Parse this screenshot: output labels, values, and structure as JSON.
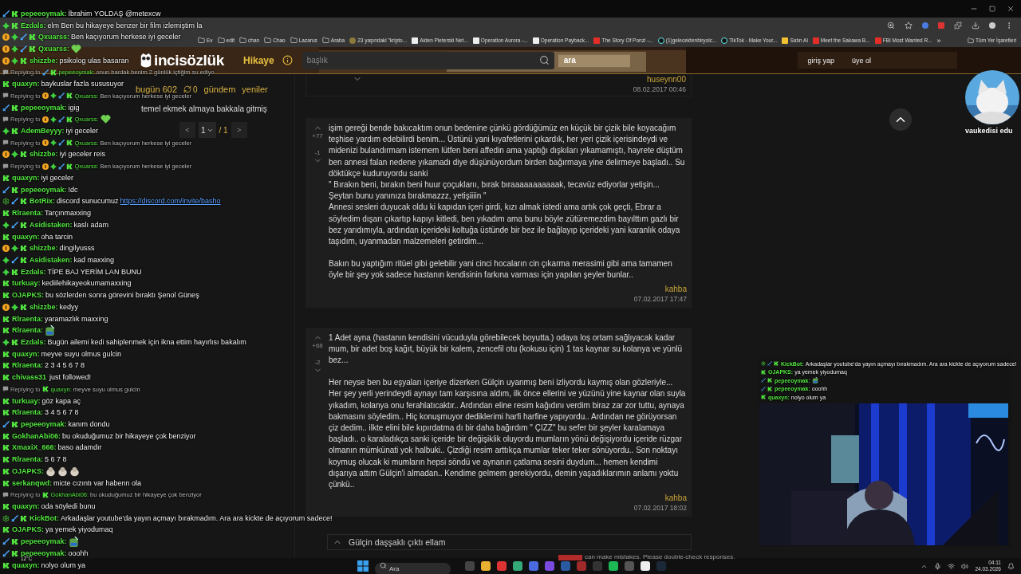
{
  "bookmarks": [
    {
      "kind": "folder",
      "label": "Ev"
    },
    {
      "kind": "folder",
      "label": "edit"
    },
    {
      "kind": "folder",
      "label": "chan"
    },
    {
      "kind": "folder",
      "label": "Chao"
    },
    {
      "kind": "folder",
      "label": "Lazarus"
    },
    {
      "kind": "folder",
      "label": "Araba"
    },
    {
      "kind": "site",
      "label": "23 yaşındaki \"kripto..."
    },
    {
      "kind": "wiki",
      "label": "Aiden Pleterski Net..."
    },
    {
      "kind": "wiki",
      "label": "Operation Aurora -..."
    },
    {
      "kind": "wiki",
      "label": "Operation Payback..."
    },
    {
      "kind": "video",
      "label": "The Story Of Ponzi -..."
    },
    {
      "kind": "tiktok",
      "label": "(1)gelecektenbiryolc..."
    },
    {
      "kind": "tiktok",
      "label": "TikTok - Make Your..."
    },
    {
      "kind": "shop",
      "label": "Satın Al"
    },
    {
      "kind": "video",
      "label": "Meet the Sakawa B..."
    },
    {
      "kind": "video",
      "label": "FBI Most Wanted R..."
    }
  ],
  "bookmarks_more": "»",
  "bookmarks_all": "Tüm Yer İşaretleri",
  "site_header": {
    "logo": "incisözlük",
    "section": "Hikaye",
    "search": {
      "placeholder": "başlık"
    },
    "search_button": "ara",
    "links": [
      "giriş yap",
      "üye ol"
    ]
  },
  "sidebar": {
    "today": "bugün 602",
    "refresh_count": "0",
    "links": [
      "gündem",
      "yeniler"
    ],
    "topic": "temel ekmek almaya bakkala gitmiş",
    "pagination": {
      "prev": "<",
      "page": "1",
      "total": "/ 1",
      "next": ">"
    }
  },
  "previous_entry": {
    "author": "huseynn00",
    "date": "08.02.2017 00:46"
  },
  "entries": [
    {
      "upvotes": "+77",
      "downvotes": "-1",
      "paragraphs": [
        [
          "işim gereği bende bakıcaktım onun bedenine çünkü gördüğümüz en küçük bir çizik bile koyacağım teşhise yardım edebilirdi benim... Üstünü yani kıyafetlerini çıkardık, her yeri çizik içerisindeydi ve midenizi bulandırmam istemem lütfen beni affedin ama yaptığı dışkıları yıkamamıştı, hayrete düştüm ben annesi falan nedene yıkamadı diye düşünüyordum birden bağırmaya yine delirmeye başladı.. Su döktükçe kuduruyordu sanki",
          "\" Bırakın beni, bırakın beni huur çoçuklarıı, bırak bıraaaaaaaaaaak, tecavüz ediyorlar yetişin...",
          "Şeytan bunu yanınıza bırakmazzz, yetişiiiin \"",
          "Annesi sesleri duyucak oldu ki kapıdan içeri girdi, kızı almak istedi ama artık çok geçti, Ebrar a söyledim dışarı çıkartıp kapıyı kitledi, ben yıkadım ama bunu böyle zütüremezdim bayılttım gazlı bir bez yarıdımıyla, ardından içerideki koltuğa üstünde bir bez ile bağlayıp içerideki yani karanlık odaya taşıdım, uyanmadan malzemeleri getirdim..."
        ],
        [
          "Bakın bu yaptığım ritüel gibi gelebilir yani cinci hocaların cin çıkarma merasimi gibi ama tamamen öyle bir şey yok sadece hastanın kendisinin farkına varması için yapılan şeyler bunlar.."
        ]
      ],
      "author": "kahba",
      "date": "07.02.2017 17:47"
    },
    {
      "upvotes": "+68",
      "downvotes": "-2",
      "paragraphs": [
        [
          "1 Adet ayna (hastanın kendisini vücuduyla görebilecek boyutta.) odaya loş ortam sağlıyacak kadar mum, bir adet boş kağıt, büyük bir kalem, zencefil otu (kokusu için) 1 tas kaynar su kolanya ve yünlü bez..."
        ],
        [
          "Her neyse ben bu eşyaları içeriye dizerken Gülçin uyanmış beni izliyordu kaymış olan gözleriyle... Her şey yerli yerindeydi aynayı tam karşısına aldım, ilk önce ellerini ve yüzünü yine kaynar olan suyla yıkadım, kolanya onu ferahlatıcaktır.. Ardından eline resim kağıdını verdim biraz zar zor tuttu, aynaya bakmasını söyledim.. Hiç konuşmuyor dediklerimi harfi harfine yapıyordu.. Ardından ne görüyorsan çiz dedim.. ilkte elini bile kıpırdatma dı bir daha bağırdım \" ÇIZZ\" bu sefer bir şeyler karalamaya başladı.. o karaladıkça sanki içeride bir değişiklik oluyordu mumların yönü değişiyordu içeride rüzgar olmanın mümkünati yok halbuki.. Çizdiği resim arttıkça mumlar teker teker sönüyordu.. Son noktayı koymuş olucak ki mumların hepsi söndü ve aynanın çatlama sesini duydum... hemen kendimi dışarıya attım Gülçin'i almadan.. Kendime gelmem gerekiyordu, demin yaşadıklarımın anlamı yoktu çünkü.."
        ]
      ],
      "author": "kahba",
      "date": "07.02.2017 18:02"
    }
  ],
  "reply_preview": "Gülçin daşşaklı çıktı ellam",
  "overlay_profile": {
    "caption": "vaukedisi edu"
  },
  "chat": [
    {
      "kind": "message",
      "badges": [
        {
          "kind": "sword"
        },
        {
          "kind": "kick"
        }
      ],
      "user": "pepeeoymak:",
      "text": "İbrahim YOLDAŞ @metexcw"
    },
    {
      "kind": "message",
      "badges": [
        {
          "kind": "gift"
        },
        {
          "kind": "kick"
        }
      ],
      "user": "Ezdals:",
      "text": "elm Ben bu hikayeye benzer bir film izlemiştim la"
    },
    {
      "kind": "message",
      "badges": [
        {
          "kind": "sub"
        },
        {
          "kind": "gift"
        },
        {
          "kind": "sword"
        },
        {
          "kind": "kick"
        }
      ],
      "user": "Qxuarss:",
      "text": "Ben kaçıyorum herkese iyi geceler"
    },
    {
      "kind": "message",
      "badges": [
        {
          "kind": "sub"
        },
        {
          "kind": "gift"
        },
        {
          "kind": "sword"
        },
        {
          "kind": "kick"
        }
      ],
      "user": "Qxuarss:",
      "emotes": [
        {
          "kind": "heart"
        }
      ]
    },
    {
      "kind": "message",
      "badges": [
        {
          "kind": "sub"
        },
        {
          "kind": "gift"
        },
        {
          "kind": "kick"
        }
      ],
      "user": "shizzbe:",
      "text": "psikolog ulas basaran"
    },
    {
      "kind": "reply",
      "label": "Replying to",
      "badges": [
        {
          "kind": "sword"
        },
        {
          "kind": "kick"
        }
      ],
      "user": "pepeeoymak:",
      "text": "onun bardak benim 2 günlük içtiğim su ediyo"
    },
    {
      "kind": "message",
      "badges": [
        {
          "kind": "kick"
        }
      ],
      "user": "quaxyn:",
      "text": "baykuslar fazla sususuyor"
    },
    {
      "kind": "reply",
      "label": "Replying to",
      "badges": [
        {
          "kind": "sub"
        },
        {
          "kind": "gift"
        },
        {
          "kind": "sword"
        },
        {
          "kind": "kick"
        }
      ],
      "user": "Qxuarss:",
      "text": "Ben kaçıyorum herkese iyi geceler"
    },
    {
      "kind": "message",
      "badges": [
        {
          "kind": "sword"
        },
        {
          "kind": "kick"
        }
      ],
      "user": "pepeeoymak:",
      "text": "igig"
    },
    {
      "kind": "reply",
      "label": "Replying to",
      "badges": [
        {
          "kind": "sub"
        },
        {
          "kind": "gift"
        },
        {
          "kind": "sword"
        },
        {
          "kind": "kick"
        }
      ],
      "user": "Qxuarss:",
      "emotes": [
        {
          "kind": "heart"
        }
      ]
    },
    {
      "kind": "message",
      "badges": [
        {
          "kind": "gift"
        },
        {
          "kind": "kick"
        }
      ],
      "user": "AdemBeyyy:",
      "text": "iyi geceler"
    },
    {
      "kind": "reply",
      "label": "Replying to",
      "badges": [
        {
          "kind": "sub"
        },
        {
          "kind": "gift"
        },
        {
          "kind": "sword"
        },
        {
          "kind": "kick"
        }
      ],
      "user": "Qxuarss:",
      "text": "Ben kaçıyorum herkese iyi geceler"
    },
    {
      "kind": "message",
      "badges": [
        {
          "kind": "sub"
        },
        {
          "kind": "gift"
        },
        {
          "kind": "kick"
        }
      ],
      "user": "shizzbe:",
      "text": "iyi geceler reis"
    },
    {
      "kind": "reply",
      "label": "Replying to",
      "badges": [
        {
          "kind": "sub"
        },
        {
          "kind": "gift"
        },
        {
          "kind": "sword"
        },
        {
          "kind": "kick"
        }
      ],
      "user": "Qxuarss:",
      "text": "Ben kaçıyorum herkese iyi geceler"
    },
    {
      "kind": "message",
      "badges": [
        {
          "kind": "kick"
        }
      ],
      "user": "quaxyn:",
      "text": "iyi geceler"
    },
    {
      "kind": "message",
      "badges": [
        {
          "kind": "sword"
        },
        {
          "kind": "kick"
        }
      ],
      "user": "pepeeoymak:",
      "text": "!dc"
    },
    {
      "kind": "message",
      "badges": [
        {
          "kind": "bot"
        },
        {
          "kind": "sword"
        },
        {
          "kind": "kick"
        }
      ],
      "user": "BotRix:",
      "text": "discord sunucumuz",
      "link": "https://discord.com/invite/basho"
    },
    {
      "kind": "message",
      "badges": [
        {
          "kind": "kick"
        }
      ],
      "user": "Rlraenta:",
      "text": "Tarçınmaxxing"
    },
    {
      "kind": "message",
      "badges": [
        {
          "kind": "gift"
        },
        {
          "kind": "sword"
        },
        {
          "kind": "kick"
        }
      ],
      "user": "Asidistaken:",
      "text": "kaslı adam"
    },
    {
      "kind": "message",
      "badges": [
        {
          "kind": "kick"
        }
      ],
      "user": "quaxyn:",
      "text": "oha tarcin"
    },
    {
      "kind": "message",
      "badges": [
        {
          "kind": "sub"
        },
        {
          "kind": "gift"
        },
        {
          "kind": "kick"
        }
      ],
      "user": "shizzbe:",
      "text": "dingilyusss"
    },
    {
      "kind": "message",
      "badges": [
        {
          "kind": "gift"
        },
        {
          "kind": "sword"
        },
        {
          "kind": "kick"
        }
      ],
      "user": "Asidistaken:",
      "text": "kad maxxing"
    },
    {
      "kind": "message",
      "badges": [
        {
          "kind": "gift"
        },
        {
          "kind": "kick"
        }
      ],
      "user": "Ezdals:",
      "text": "TİPE BAJ YERİM LAN BUNU"
    },
    {
      "kind": "message",
      "badges": [
        {
          "kind": "kick"
        }
      ],
      "user": "turkuay:",
      "text": "kediilehikayeokumamaxxing"
    },
    {
      "kind": "message",
      "badges": [
        {
          "kind": "kick"
        }
      ],
      "user": "OJAPKS:",
      "text": "bu sözlerden sonra görevini bıraktı Şenol Güneş"
    },
    {
      "kind": "message",
      "badges": [
        {
          "kind": "sub"
        },
        {
          "kind": "gift"
        },
        {
          "kind": "kick"
        }
      ],
      "user": "shizzbe:",
      "text": "kedyy"
    },
    {
      "kind": "message",
      "badges": [
        {
          "kind": "kick"
        }
      ],
      "user": "Rlraenta:",
      "text": "yaramazlık maxxing"
    },
    {
      "kind": "message",
      "badges": [
        {
          "kind": "kick"
        }
      ],
      "user": "Rlraenta:",
      "emotes": [
        {
          "kind": "frog"
        }
      ]
    },
    {
      "kind": "message",
      "badges": [
        {
          "kind": "gift"
        },
        {
          "kind": "kick"
        }
      ],
      "user": "Ezdals:",
      "text": "Bugün ailemi kedi sahiplenmek için ikna ettim hayırlısı bakalım"
    },
    {
      "kind": "message",
      "badges": [
        {
          "kind": "kick"
        }
      ],
      "user": "quaxyn:",
      "text": "meyve suyu olmus gulcin"
    },
    {
      "kind": "message",
      "badges": [
        {
          "kind": "kick"
        }
      ],
      "user": "Rlraenta:",
      "text": "2 3 4 5 6 7 8"
    },
    {
      "kind": "follow",
      "badges": [
        {
          "kind": "kick"
        }
      ],
      "user": "chivass31",
      "text": "just followed!"
    },
    {
      "kind": "reply",
      "label": "Replying to",
      "badges": [
        {
          "kind": "kick"
        }
      ],
      "user": "quaxyn:",
      "text": "meyve suyu olmus gulcin"
    },
    {
      "kind": "message",
      "badges": [
        {
          "kind": "kick"
        }
      ],
      "user": "turkuay:",
      "text": "göz kapa aç"
    },
    {
      "kind": "message",
      "badges": [
        {
          "kind": "kick"
        }
      ],
      "user": "Rlraenta:",
      "text": "3 4 5 6 7 8"
    },
    {
      "kind": "message",
      "badges": [
        {
          "kind": "sword"
        },
        {
          "kind": "kick"
        }
      ],
      "user": "pepeeoymak:",
      "text": "kanım dondu"
    },
    {
      "kind": "message",
      "badges": [
        {
          "kind": "kick"
        }
      ],
      "user": "GokhanAbi06:",
      "text": "bu okuduğumuz bir hikayeye çok benziyor"
    },
    {
      "kind": "message",
      "badges": [
        {
          "kind": "kick"
        }
      ],
      "user": "XmaxiX_666:",
      "text": "baso adamdır"
    },
    {
      "kind": "message",
      "badges": [
        {
          "kind": "kick"
        }
      ],
      "user": "Rlraenta:",
      "text": "5 6 7 8"
    },
    {
      "kind": "message",
      "badges": [
        {
          "kind": "kick"
        }
      ],
      "user": "OJAPKS:",
      "emotes": [
        {
          "kind": "pigeon"
        },
        {
          "kind": "pigeon"
        },
        {
          "kind": "pigeon"
        }
      ]
    },
    {
      "kind": "message",
      "badges": [
        {
          "kind": "kick"
        }
      ],
      "user": "serkanqwd:",
      "text": "micte cızıntı var habenn ola"
    },
    {
      "kind": "reply",
      "label": "Replying to",
      "badges": [
        {
          "kind": "kick"
        }
      ],
      "user": "GokhanAbi06:",
      "text": "bu okuduğumuz bir hikayeye çok benziyor"
    },
    {
      "kind": "message",
      "badges": [
        {
          "kind": "kick"
        }
      ],
      "user": "quaxyn:",
      "text": "oda söyledi bunu"
    },
    {
      "kind": "message",
      "badges": [
        {
          "kind": "bot"
        },
        {
          "kind": "sword"
        },
        {
          "kind": "kick"
        }
      ],
      "user": "KickBot:",
      "text": "Arkadaşlar youtube'da yayın açmayı bırakmadım. Ara ara kickte de açıyorum sadece!"
    },
    {
      "kind": "message",
      "badges": [
        {
          "kind": "kick"
        }
      ],
      "user": "OJAPKS:",
      "text": "ya yemek yiyodumaq"
    },
    {
      "kind": "message",
      "badges": [
        {
          "kind": "sword"
        },
        {
          "kind": "kick"
        }
      ],
      "user": "pepeeoymak:",
      "emotes": [
        {
          "kind": "frog"
        }
      ]
    },
    {
      "kind": "message",
      "badges": [
        {
          "kind": "sword"
        },
        {
          "kind": "kick"
        }
      ],
      "user": "pepeeoymak:",
      "text": "ooohh"
    },
    {
      "kind": "message",
      "badges": [
        {
          "kind": "kick"
        }
      ],
      "user": "quaxyn:",
      "text": "nolyo olum ya"
    }
  ],
  "mini_chat": [
    {
      "kind": "message",
      "badges": [
        {
          "kind": "bot"
        },
        {
          "kind": "sword"
        },
        {
          "kind": "kick"
        }
      ],
      "user": "KickBot:",
      "text": "Arkadaşlar youtube'da yayın açmayı bırakmadım. Ara ara kickte de açıyorum sadece!"
    },
    {
      "kind": "message",
      "badges": [
        {
          "kind": "kick"
        }
      ],
      "user": "OJAPKS:",
      "text": "ya yemek yiyodumaq"
    },
    {
      "kind": "message",
      "badges": [
        {
          "kind": "sword"
        },
        {
          "kind": "kick"
        }
      ],
      "user": "pepeeoymak:",
      "emotes": [
        {
          "kind": "frog"
        }
      ]
    },
    {
      "kind": "message",
      "badges": [
        {
          "kind": "sword"
        },
        {
          "kind": "kick"
        }
      ],
      "user": "pepeeoymak:",
      "text": "ooohh"
    },
    {
      "kind": "message",
      "badges": [
        {
          "kind": "kick"
        }
      ],
      "user": "quaxyn:",
      "text": "nolyo olum ya"
    }
  ],
  "notice": "can make mistakes. Please double-check responses.",
  "taskbar": {
    "weather": "12°C",
    "search": {
      "placeholder": "Ara"
    },
    "time": "04:11",
    "date": "24.03.2026"
  }
}
